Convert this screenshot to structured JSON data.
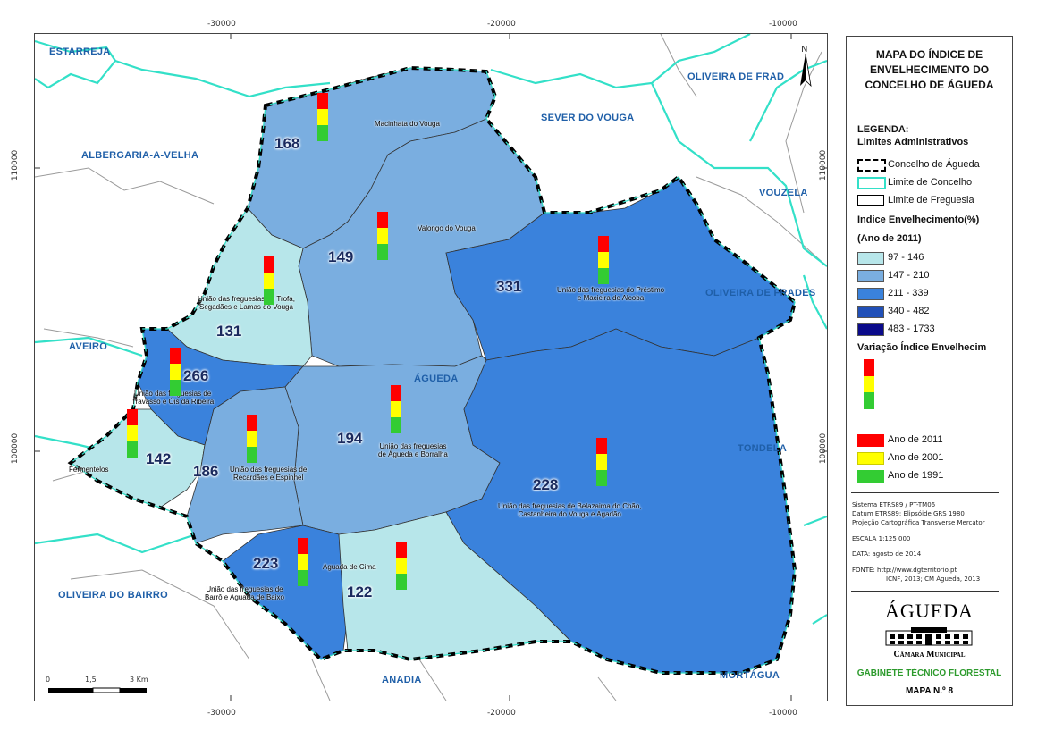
{
  "coordinates": {
    "top": [
      "-30000",
      "-20000",
      "-10000"
    ],
    "bottom": [
      "-30000",
      "-20000",
      "-10000"
    ],
    "left": [
      "110000",
      "100000"
    ],
    "right": [
      "110000",
      "100000"
    ]
  },
  "municipalities": [
    "ESTARREJA",
    "ALBERGARIA-A-VELHA",
    "SEVER DO VOUGA",
    "OLIVEIRA DE FRAD",
    "VOUZELA",
    "OLIVEIRA DE FRADES",
    "AVEIRO",
    "TONDELA",
    "OLIVEIRA DO BAIRRO",
    "ANADIA",
    "MORTÁGUA",
    "ÁGUEDA"
  ],
  "parishes": [
    {
      "name": [
        "Macinhata do Vouga"
      ],
      "index": "168"
    },
    {
      "name": [
        "Valongo do Vouga"
      ],
      "index": "149"
    },
    {
      "name": [
        "União das freguesias de Trofa,",
        "Segadães e Lamas do Vouga"
      ],
      "index": "131"
    },
    {
      "name": [
        "União das freguesias do Préstimo",
        "e Macieira de Alcoba"
      ],
      "index": "331"
    },
    {
      "name": [
        "União das freguesias de",
        "Travassô e Óis da Ribeira"
      ],
      "index": "266"
    },
    {
      "name": [
        "União das freguesias",
        "de Águeda e Borralha"
      ],
      "index": "194"
    },
    {
      "name": [
        "Fermentelos"
      ],
      "index": "142"
    },
    {
      "name": [
        "União das freguesias de",
        "Recardães e Espinhel"
      ],
      "index": "186"
    },
    {
      "name": [
        "União das freguesias de Belazaima do Chão,",
        "Castanheira do Vouga e Agadão"
      ],
      "index": "228"
    },
    {
      "name": [
        "União das freguesias de",
        "Barrô e Aguada de Baixo"
      ],
      "index": "223"
    },
    {
      "name": [
        "Aguada de Cima"
      ],
      "index": "122"
    }
  ],
  "scale_bar": {
    "labels": [
      "0",
      "1,5",
      "3 Km"
    ]
  },
  "north_label": "N",
  "legend": {
    "title": [
      "MAPA DO ÍNDICE DE",
      "ENVELHECIMENTO DO",
      "CONCELHO DE ÁGUEDA"
    ],
    "heading": "LEGENDA:",
    "limits_heading": "Limites Administrativos",
    "limits": [
      "Concelho de Águeda",
      "Limite de Concelho",
      "Limite de Freguesia"
    ],
    "index_heading": "Indice Envelhecimento(%)",
    "index_year": "(Ano de 2011)",
    "classes": [
      {
        "label": "97 - 146",
        "color": "#b7e6ea"
      },
      {
        "label": "147 - 210",
        "color": "#7aaee0"
      },
      {
        "label": "211 - 339",
        "color": "#3a82dc"
      },
      {
        "label": "340 - 482",
        "color": "#2150b8"
      },
      {
        "label": "483 - 1733",
        "color": "#0a0a8a"
      }
    ],
    "variation_heading": "Variação Índice Envelhecim",
    "years": [
      {
        "label": "Ano de 2011",
        "color": "#ff0000"
      },
      {
        "label": "Ano de 2001",
        "color": "#ffff00"
      },
      {
        "label": "Ano de 1991",
        "color": "#33cc33"
      }
    ],
    "metadata": [
      "Sistema ETRS89 / PT-TM06",
      "Datum ETRS89;  Elipsóide GRS 1980",
      "Projeção Cartográfica Transverse Mercator",
      "ESCALA  1:125 000",
      "DATA:    agosto de 2014",
      "FONTE: http://www.dgterritorio.pt",
      "ICNF, 2013;  CM Águeda, 2013"
    ],
    "logo_title": "ÁGUEDA",
    "logo_subtitle": "Câmara Municipal",
    "office": "GABINETE TÉCNICO FLORESTAL",
    "map_number": "MAPA N.º 8"
  }
}
